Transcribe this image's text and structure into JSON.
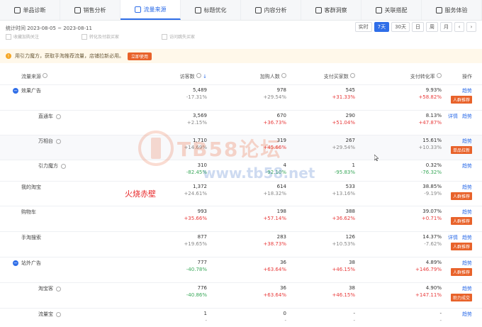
{
  "tabs": [
    {
      "label": "单品诊断",
      "icon": "diagnosis-icon",
      "active": false
    },
    {
      "label": "销售分析",
      "icon": "sales-chart-icon",
      "active": false
    },
    {
      "label": "流量来源",
      "icon": "traffic-icon",
      "active": true
    },
    {
      "label": "标题优化",
      "icon": "title-icon",
      "active": false
    },
    {
      "label": "内容分析",
      "icon": "content-icon",
      "active": false
    },
    {
      "label": "客群洞察",
      "icon": "audience-icon",
      "active": false
    },
    {
      "label": "关联搭配",
      "icon": "link-icon",
      "active": false
    },
    {
      "label": "服务体验",
      "icon": "service-icon",
      "active": false
    }
  ],
  "stat_time": "统计时间 2023-08-05 ~ 2023-08-11",
  "period_buttons": [
    "实时",
    "7天",
    "30天",
    "日",
    "周",
    "月"
  ],
  "active_period": "7天",
  "nav_prev": "‹",
  "nav_next": "›",
  "checkboxes": [
    "收藏加购关注",
    "转化及付款买家",
    "访问跳失买家"
  ],
  "banner": {
    "text": "用引力魔方，获取手淘推荐流量，店铺拉新必用。",
    "button": "立即使用"
  },
  "columns": [
    "流量来源",
    "访客数",
    "加购人数",
    "支付买家数",
    "支付转化率",
    "操作"
  ],
  "sort_icon": "↓",
  "rows": [
    {
      "source": "效果广告",
      "level": 1,
      "toggle": "−",
      "visitors": "5,489",
      "visitors_chg": "-17.31%",
      "v_dir": "neutral",
      "cart": "978",
      "cart_chg": "+29.54%",
      "c_dir": "neutral",
      "buyers": "545",
      "buyers_chg": "+31.33%",
      "b_dir": "up",
      "rate": "9.93%",
      "rate_chg": "+58.82%",
      "r_dir": "up",
      "links": [
        "趋势"
      ],
      "tag": "人群推荐",
      "hl": false
    },
    {
      "source": "直通车",
      "level": 2,
      "visitors": "3,569",
      "visitors_chg": "+2.15%",
      "v_dir": "neutral",
      "cart": "670",
      "cart_chg": "+36.73%",
      "c_dir": "up",
      "buyers": "290",
      "buyers_chg": "+51.04%",
      "b_dir": "up",
      "rate": "8.13%",
      "rate_chg": "+47.87%",
      "r_dir": "up",
      "links": [
        "详情",
        "趋势"
      ],
      "tag": "",
      "hl": false
    },
    {
      "source": "万相台",
      "level": 2,
      "visitors": "1,710",
      "visitors_chg": "+14.69%",
      "v_dir": "neutral",
      "cart": "319",
      "cart_chg": "+45.66%",
      "c_dir": "up",
      "buyers": "267",
      "buyers_chg": "+29.54%",
      "b_dir": "neutral",
      "rate": "15.61%",
      "rate_chg": "+10.33%",
      "r_dir": "neutral",
      "links": [
        "趋势"
      ],
      "tag": "单品拉新",
      "hl": true
    },
    {
      "source": "引力魔方",
      "level": 2,
      "visitors": "310",
      "visitors_chg": "-82.45%",
      "v_dir": "down",
      "cart": "4",
      "cart_chg": "-92.10%",
      "c_dir": "down",
      "buyers": "1",
      "buyers_chg": "-95.83%",
      "b_dir": "down",
      "rate": "0.32%",
      "rate_chg": "-76.32%",
      "r_dir": "down",
      "links": [
        "趋势"
      ],
      "tag": "",
      "hl": false
    },
    {
      "source": "我的淘宝",
      "level": 1,
      "visitors": "1,372",
      "visitors_chg": "+24.61%",
      "v_dir": "neutral",
      "cart": "614",
      "cart_chg": "+18.32%",
      "c_dir": "neutral",
      "buyers": "533",
      "buyers_chg": "+13.16%",
      "b_dir": "neutral",
      "rate": "38.85%",
      "rate_chg": "-9.19%",
      "r_dir": "neutral",
      "links": [
        "趋势"
      ],
      "tag": "人群推荐",
      "hl": false
    },
    {
      "source": "购物车",
      "level": 1,
      "visitors": "993",
      "visitors_chg": "+35.66%",
      "v_dir": "up",
      "cart": "198",
      "cart_chg": "+57.14%",
      "c_dir": "up",
      "buyers": "388",
      "buyers_chg": "+36.62%",
      "b_dir": "up",
      "rate": "39.07%",
      "rate_chg": "+0.71%",
      "r_dir": "up",
      "links": [
        "趋势"
      ],
      "tag": "人群推荐",
      "hl": false
    },
    {
      "source": "手淘搜索",
      "level": 1,
      "visitors": "877",
      "visitors_chg": "+19.65%",
      "v_dir": "neutral",
      "cart": "283",
      "cart_chg": "+38.73%",
      "c_dir": "up",
      "buyers": "126",
      "buyers_chg": "+10.53%",
      "b_dir": "neutral",
      "rate": "14.37%",
      "rate_chg": "-7.62%",
      "r_dir": "neutral",
      "links": [
        "详情",
        "趋势"
      ],
      "tag": "人群推荐",
      "hl": false
    },
    {
      "source": "站外广告",
      "level": 1,
      "toggle": "−",
      "visitors": "777",
      "visitors_chg": "-40.78%",
      "v_dir": "down",
      "cart": "36",
      "cart_chg": "+63.64%",
      "c_dir": "up",
      "buyers": "38",
      "buyers_chg": "+46.15%",
      "b_dir": "up",
      "rate": "4.89%",
      "rate_chg": "+146.79%",
      "r_dir": "up",
      "links": [
        "趋势"
      ],
      "tag": "人群推荐",
      "hl": false
    },
    {
      "source": "淘宝客",
      "level": 2,
      "visitors": "776",
      "visitors_chg": "-40.86%",
      "v_dir": "down",
      "cart": "36",
      "cart_chg": "+63.64%",
      "c_dir": "up",
      "buyers": "38",
      "buyers_chg": "+46.15%",
      "b_dir": "up",
      "rate": "4.90%",
      "rate_chg": "+147.11%",
      "r_dir": "up",
      "links": [
        "趋势"
      ],
      "tag": "助力成交",
      "hl": false
    },
    {
      "source": "流量宝",
      "level": 2,
      "visitors": "1",
      "visitors_chg": "-",
      "v_dir": "neutral",
      "cart": "0",
      "cart_chg": "-",
      "c_dir": "neutral",
      "buyers": "-",
      "buyers_chg": "-",
      "b_dir": "neutral",
      "rate": "-",
      "rate_chg": "-",
      "r_dir": "neutral",
      "links": [
        "趋势"
      ],
      "tag": "",
      "hl": false
    }
  ],
  "watermark": {
    "brand": "TB58论坛",
    "url": "www.tb58.net"
  },
  "annotation": "火烧赤壁"
}
